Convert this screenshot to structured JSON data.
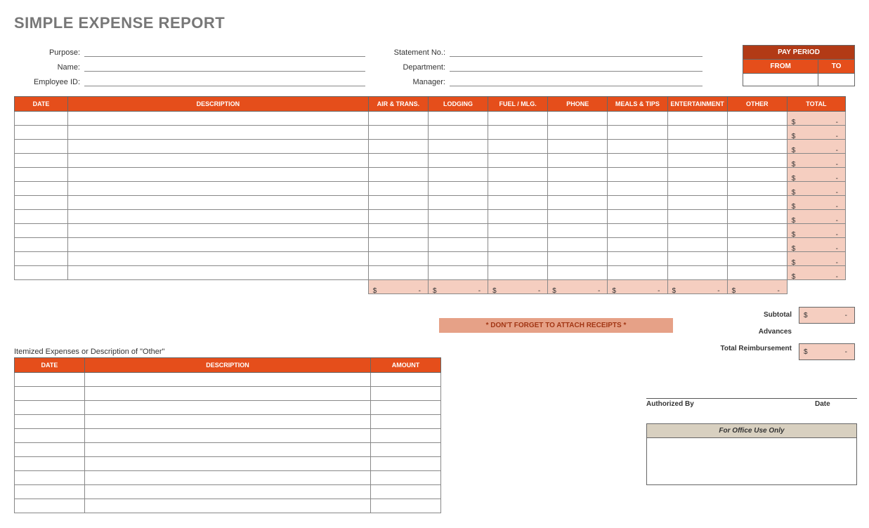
{
  "title": "SIMPLE EXPENSE REPORT",
  "form": {
    "left": [
      {
        "label": "Purpose:",
        "value": ""
      },
      {
        "label": "Name:",
        "value": ""
      },
      {
        "label": "Employee ID:",
        "value": ""
      }
    ],
    "mid": [
      {
        "label": "Statement No.:",
        "value": ""
      },
      {
        "label": "Department:",
        "value": ""
      },
      {
        "label": "Manager:",
        "value": ""
      }
    ]
  },
  "pay_period": {
    "header": "PAY PERIOD",
    "from_label": "FROM",
    "to_label": "TO",
    "from": "",
    "to": ""
  },
  "main_columns": [
    "DATE",
    "DESCRIPTION",
    "AIR & TRANS.",
    "LODGING",
    "FUEL / MLG.",
    "PHONE",
    "MEALS & TIPS",
    "ENTERTAINMENT",
    "OTHER",
    "TOTAL"
  ],
  "main_rows": 12,
  "currency": "$",
  "dash": "-",
  "summary": {
    "subtotal_label": "Subtotal",
    "advances_label": "Advances",
    "total_label": "Total Reimbursement"
  },
  "receipts_note": "* DON'T FORGET TO ATTACH RECEIPTS *",
  "itemized_heading": "Itemized Expenses or Description of \"Other\"",
  "itemized_columns": [
    "DATE",
    "DESCRIPTION",
    "AMOUNT"
  ],
  "itemized_rows": 10,
  "signature": {
    "auth_label": "Authorized By",
    "date_label": "Date"
  },
  "office_use": "For Office Use Only"
}
